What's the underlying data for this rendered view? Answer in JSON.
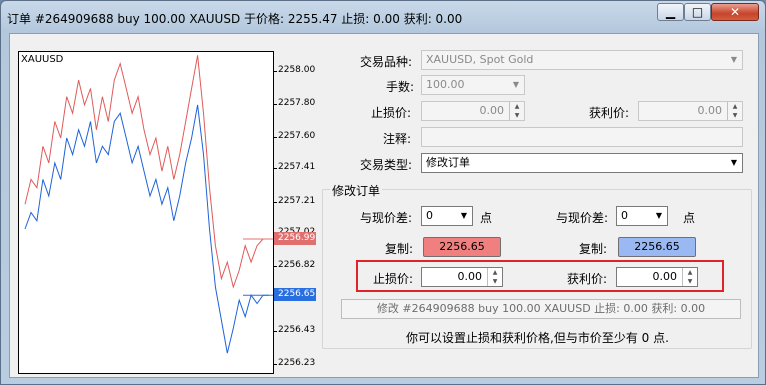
{
  "window": {
    "title": "订单 #264909688 buy 100.00 XAUUSD 于价格: 2255.47 止损: 0.00 获利: 0.00",
    "min_glyph": "▁",
    "max_glyph": "□",
    "close_glyph": "✕"
  },
  "chart": {
    "symbol": "XAUUSD",
    "ticks": [
      "2258.00",
      "2257.80",
      "2257.60",
      "2257.41",
      "2257.21",
      "2257.02",
      "2256.82",
      "2256.62",
      "2256.43",
      "2256.23"
    ],
    "ask_tag": "2256.99",
    "bid_tag": "2256.65",
    "colors": {
      "ask": "#e07070",
      "bid": "#2a6fe0"
    }
  },
  "chart_data": {
    "type": "line",
    "title": "XAUUSD",
    "ylim": [
      2256.18,
      2258.12
    ],
    "series": [
      {
        "color": "#e05a5a",
        "values": [
          2257.2,
          2257.35,
          2257.3,
          2257.55,
          2257.45,
          2257.7,
          2257.6,
          2257.85,
          2257.75,
          2257.95,
          2257.8,
          2257.9,
          2257.65,
          2257.85,
          2257.7,
          2257.95,
          2258.05,
          2257.9,
          2257.75,
          2257.85,
          2257.65,
          2257.5,
          2257.6,
          2257.4,
          2257.55,
          2257.35,
          2257.5,
          2257.7,
          2257.9,
          2258.1,
          2257.75,
          2257.3,
          2256.95,
          2256.75,
          2256.85,
          2256.7,
          2256.8,
          2256.95,
          2256.85,
          2256.95,
          2256.99,
          2256.99
        ]
      },
      {
        "color": "#1f63d8",
        "values": [
          2257.05,
          2257.15,
          2257.1,
          2257.35,
          2257.25,
          2257.45,
          2257.35,
          2257.6,
          2257.5,
          2257.65,
          2257.55,
          2257.7,
          2257.45,
          2257.55,
          2257.5,
          2257.7,
          2257.75,
          2257.6,
          2257.45,
          2257.55,
          2257.4,
          2257.25,
          2257.35,
          2257.2,
          2257.3,
          2257.1,
          2257.25,
          2257.45,
          2257.6,
          2257.8,
          2257.5,
          2257.05,
          2256.7,
          2256.5,
          2256.3,
          2256.45,
          2256.62,
          2256.52,
          2256.65,
          2256.6,
          2256.65,
          2256.65
        ]
      }
    ]
  },
  "form": {
    "symbol_label": "交易品种:",
    "symbol_value": "XAUUSD, Spot Gold",
    "volume_label": "手数:",
    "volume_value": "100.00",
    "sl_label": "止损价:",
    "sl_value": "0.00",
    "tp_label": "获利价:",
    "tp_value": "0.00",
    "comment_label": "注释:",
    "comment_value": "",
    "type_label": "交易类型:",
    "type_value": "修改订单"
  },
  "modify": {
    "group_title": "修改订单",
    "sl_diff_label": "与现价差:",
    "sl_diff_value": "0",
    "points_unit": "点",
    "tp_diff_label": "与现价差:",
    "tp_diff_value": "0",
    "copy_label_left": "复制:",
    "copy_value_left": "2256.65",
    "copy_label_right": "复制:",
    "copy_value_right": "2256.65",
    "sl_label": "止损价:",
    "sl_value": "0.00",
    "tp_label": "获利价:",
    "tp_value": "0.00",
    "modify_button": "修改 #264909688 buy 100.00 XAUUSD 止损: 0.00 获利: 0.00",
    "note": "你可以设置止损和获利价格,但与市价至少有 0 点.",
    "colors": {
      "copy_left": "#f08080",
      "copy_right": "#9ab8f2",
      "highlight": "#e0232a"
    }
  }
}
